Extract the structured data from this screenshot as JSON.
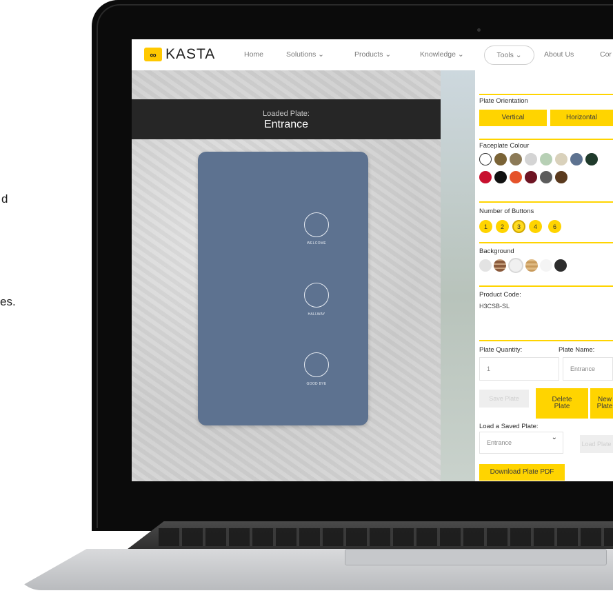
{
  "marketing": {
    "line1": "d",
    "line2": "es."
  },
  "nav": {
    "logo_mark": "∞",
    "logo_text": "KASTA",
    "items": [
      "Home",
      "Solutions ⌄",
      "Products ⌄",
      "Knowledge ⌄"
    ],
    "tools": "Tools ⌄",
    "about": "About Us",
    "contact": "Cor"
  },
  "preview": {
    "loaded_label": "Loaded Plate:",
    "loaded_name": "Entrance",
    "plate_color": "#5d7290",
    "buttons": [
      "WELCOME",
      "HALLWAY",
      "GOOD BYE"
    ]
  },
  "panel": {
    "orientation_title": "Plate Orientation",
    "vertical": "Vertical",
    "horizontal": "Horizontal",
    "colour_title": "Faceplate Colour",
    "colours_row1": [
      "#ffffff",
      "#7a6336",
      "#8c7a57",
      "#d4d4d4",
      "#b7d0b5",
      "#d9d1bb",
      "#5d7290",
      "#1f3a2b"
    ],
    "colours_row2": [
      "#c8102e",
      "#111111",
      "#e5532a",
      "#6e1423",
      "#5c5c5c",
      "#5a3a1e"
    ],
    "buttons_title": "Number of Buttons",
    "button_counts": [
      "1",
      "2",
      "3",
      "4",
      "6"
    ],
    "selected_count": "3",
    "background_title": "Background",
    "product_code_title": "Product Code:",
    "product_code": "H3CSB-SL",
    "quantity_title": "Plate Quantity:",
    "quantity_value": "1",
    "name_title": "Plate Name:",
    "name_value": "Entrance",
    "save_plate": "Save Plate",
    "delete_plate": "Delete Plate",
    "new_plate": "New Plate",
    "load_title": "Load a Saved Plate:",
    "load_value": "Entrance",
    "load_btn": "Load Plate",
    "download": "Download Plate PDF",
    "accent": "#ffd400"
  }
}
